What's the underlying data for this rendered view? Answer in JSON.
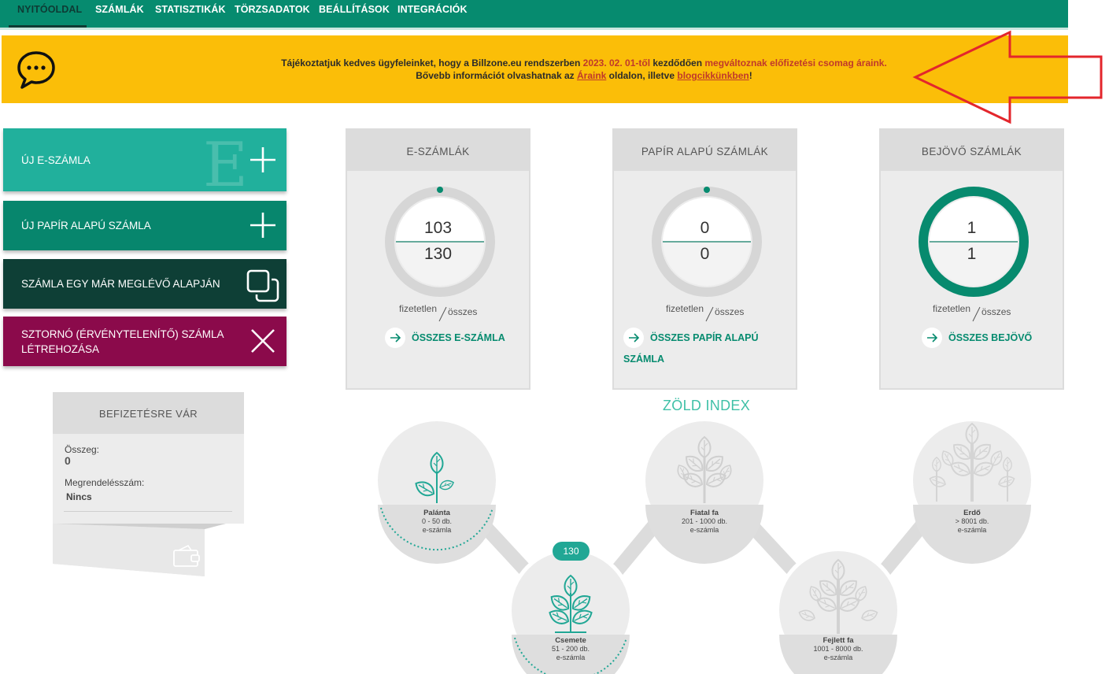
{
  "nav": {
    "items": [
      "NYITÓOLDAL",
      "SZÁMLÁK",
      "STATISZTIKÁK",
      "TÖRZSADATOK",
      "BEÁLLÍTÁSOK",
      "INTEGRÁCIÓK"
    ]
  },
  "banner": {
    "l1_a": "Tájékoztatjuk kedves ügyfeleinket, hogy a Billzone.eu rendszerben ",
    "l1_date": "2023. 02. 01-től",
    "l1_b": " kezdődően ",
    "l1_c": "megváltoznak előfizetési csomag áraink.",
    "l2_a": "Bővebb információt olvashatnak az ",
    "l2_link1": "Áraink",
    "l2_b": " oldalon, illetve ",
    "l2_link2": "blogcikkünkben",
    "l2_c": "!"
  },
  "actions": {
    "new_einvoice": "ÚJ E-SZÁMLA",
    "new_einvoice_watermark": "E",
    "new_paper": "ÚJ PAPÍR ALAPÚ SZÁMLA",
    "from_existing": "SZÁMLA EGY MÁR MEGLÉVŐ ALAPJÁN",
    "storno_1": "SZTORNÓ (ÉRVÉNYTELENÍTŐ) SZÁMLA",
    "storno_2": "LÉTREHOZÁSA"
  },
  "waiting": {
    "title": "BEFIZETÉSRE VÁR",
    "amount_label": "Összeg:",
    "amount_value": "0",
    "order_label": "Megrendelésszám:",
    "order_value": "Nincs"
  },
  "cards": [
    {
      "title": "E-SZÁMLÁK",
      "unpaid": "103",
      "total": "130",
      "unpaid_label": "fizetetlen",
      "total_label": "összes",
      "link": "ÖSSZES E-SZÁMLA"
    },
    {
      "title": "PAPÍR ALAPÚ SZÁMLÁK",
      "unpaid": "0",
      "total": "0",
      "unpaid_label": "fizetetlen",
      "total_label": "összes",
      "link": "ÖSSZES PAPÍR ALAPÚ SZÁMLA"
    },
    {
      "title": "BEJÖVŐ SZÁMLÁK",
      "unpaid": "1",
      "total": "1",
      "unpaid_label": "fizetetlen",
      "total_label": "összes",
      "link": "ÖSSZES BEJÖVŐ"
    }
  ],
  "green_index": {
    "title": "ZÖLD INDEX",
    "current_count": "130",
    "levels": [
      {
        "name": "Palánta",
        "range": "0 - 50 db.",
        "unit": "e-számla"
      },
      {
        "name": "Csemete",
        "range": "51 - 200 db.",
        "unit": "e-számla"
      },
      {
        "name": "Fiatal fa",
        "range": "201 - 1000 db.",
        "unit": "e-számla"
      },
      {
        "name": "Fejlett fa",
        "range": "1001 - 8000 db.",
        "unit": "e-számla"
      },
      {
        "name": "Erdő",
        "range": "> 8001 db.",
        "unit": "e-számla"
      }
    ]
  },
  "colors": {
    "nav_green": "#068b6f",
    "banner_yellow": "#fbbe08",
    "teal": "#21b09c",
    "dark_green": "#0e3f36",
    "magenta": "#8b0a4b",
    "arrow_red": "#e3262c"
  }
}
